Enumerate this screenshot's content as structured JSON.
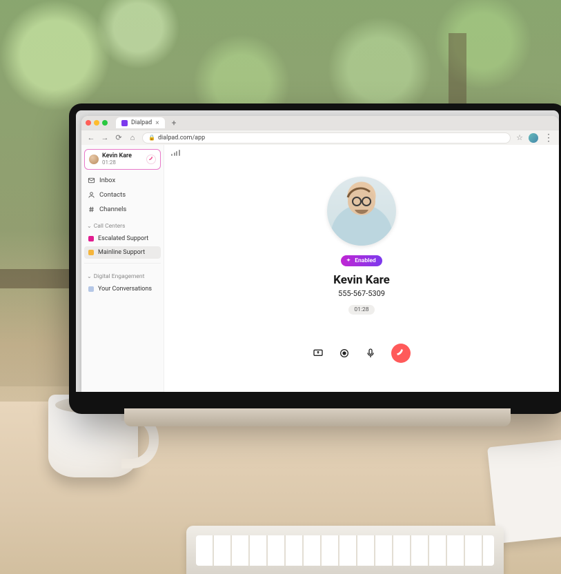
{
  "browser": {
    "tab_title": "Dialpad",
    "url": "dialpad.com/app"
  },
  "sidebar": {
    "active_call": {
      "name": "Kevin Kare",
      "time": "01:28"
    },
    "nav": [
      {
        "icon": "inbox",
        "label": "Inbox"
      },
      {
        "icon": "contacts",
        "label": "Contacts"
      },
      {
        "icon": "channels",
        "label": "Channels"
      }
    ],
    "sections": [
      {
        "title": "Call Centers",
        "items": [
          {
            "label": "Escalated Support",
            "color": "#e11d8f",
            "selected": false
          },
          {
            "label": "Mainline Support",
            "color": "#f5b53c",
            "selected": true
          }
        ]
      },
      {
        "title": "Digital Engagement",
        "items": [
          {
            "label": "Your Conversations",
            "color": "#b5c7e6",
            "selected": false
          }
        ]
      }
    ]
  },
  "main": {
    "badge": "Enabled",
    "contact_name": "Kevin Kare",
    "contact_phone": "555-567-5309",
    "duration": "01:28"
  },
  "colors": {
    "accent_pink": "#e879c9",
    "gradient_a": "#c026d3",
    "gradient_b": "#7c3aed",
    "hangup": "#ff5a5a"
  }
}
